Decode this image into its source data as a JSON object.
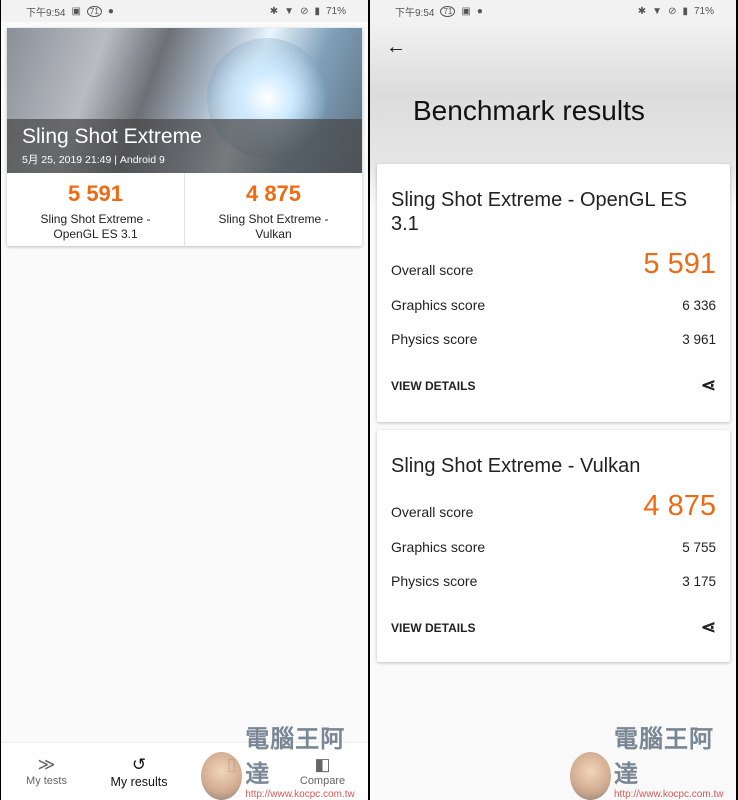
{
  "status_left": {
    "time": "下午9:54",
    "badge": "71",
    "battery": "71%"
  },
  "status_right": {
    "time": "下午9:54",
    "badge": "71",
    "battery": "71%"
  },
  "left": {
    "hero": {
      "title": "Sling Shot Extreme",
      "subtitle": "5月 25, 2019 21:49 | Android 9"
    },
    "results": [
      {
        "score": "5 591",
        "line1": "Sling Shot Extreme -",
        "line2": "OpenGL ES 3.1"
      },
      {
        "score": "4 875",
        "line1": "Sling Shot Extreme -",
        "line2": "Vulkan"
      }
    ],
    "nav": [
      {
        "label": "My tests",
        "icon": "sling-icon"
      },
      {
        "label": "My results",
        "icon": "history-icon"
      },
      {
        "label": "",
        "icon": "device-icon"
      },
      {
        "label": "Compare",
        "icon": "compare-icon"
      }
    ]
  },
  "right": {
    "title": "Benchmark results",
    "cards": [
      {
        "title": "Sling Shot Extreme - OpenGL ES 3.1",
        "overall_label": "Overall score",
        "overall": "5 591",
        "graphics_label": "Graphics score",
        "graphics": "6 336",
        "physics_label": "Physics score",
        "physics": "3 961",
        "details": "VIEW DETAILS"
      },
      {
        "title": "Sling Shot Extreme - Vulkan",
        "overall_label": "Overall score",
        "overall": "4 875",
        "graphics_label": "Graphics score",
        "graphics": "5 755",
        "physics_label": "Physics score",
        "physics": "3 175",
        "details": "VIEW DETAILS"
      }
    ]
  },
  "watermark": {
    "name": "電腦王阿達",
    "url": "http://www.kocpc.com.tw"
  },
  "colors": {
    "accent": "#f06a14"
  }
}
